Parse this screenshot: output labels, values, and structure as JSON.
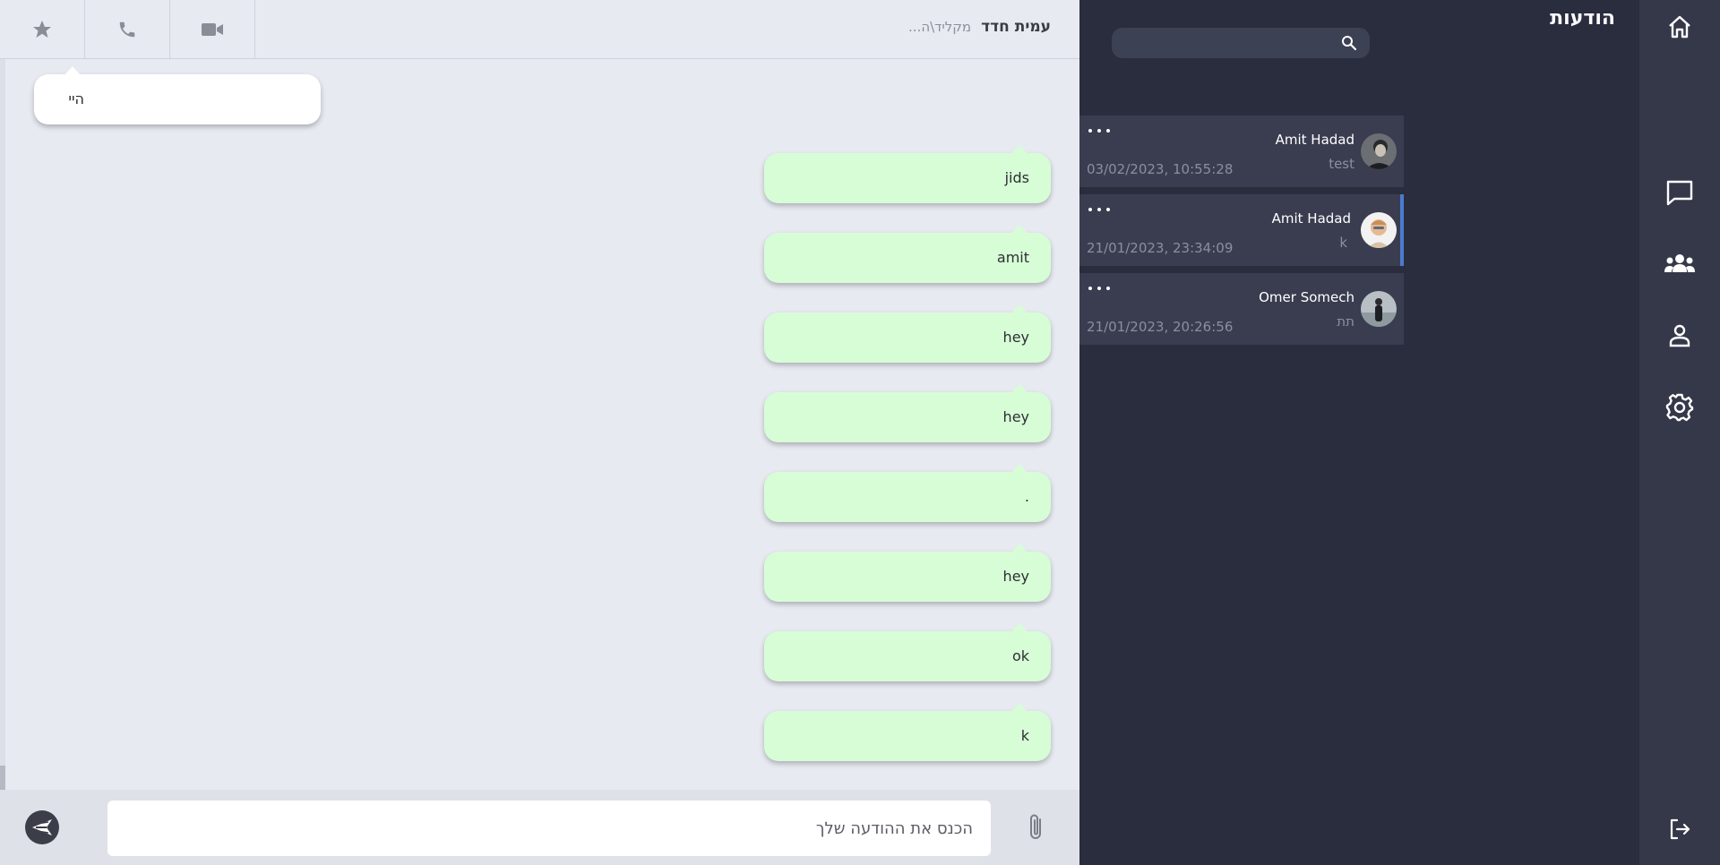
{
  "header": {
    "contact_name": "עמית חדד",
    "status": "מקליד\\ה..."
  },
  "page_title": "הודעות",
  "messages": [
    {
      "dir": "in",
      "text": "היי"
    },
    {
      "dir": "out",
      "text": "jids"
    },
    {
      "dir": "out",
      "text": "amit"
    },
    {
      "dir": "out",
      "text": "hey"
    },
    {
      "dir": "out",
      "text": "hey"
    },
    {
      "dir": "out",
      "text": "."
    },
    {
      "dir": "out",
      "text": "hey"
    },
    {
      "dir": "out",
      "text": "ok"
    },
    {
      "dir": "out",
      "text": "k"
    }
  ],
  "composer": {
    "placeholder": "הכנס את ההודעה שלך"
  },
  "search": {
    "placeholder": ""
  },
  "conversations": [
    {
      "name": "Amit Hadad",
      "preview": "test",
      "time": "03/02/2023, 10:55:28",
      "active": false
    },
    {
      "name": "Amit Hadad",
      "preview": "k",
      "time": "21/01/2023, 23:34:09",
      "active": true
    },
    {
      "name": "Omer Somech",
      "preview": "תת",
      "time": "21/01/2023, 20:26:56",
      "active": false
    }
  ],
  "icons": {
    "header": [
      "star-icon",
      "phone-icon",
      "video-icon"
    ],
    "nav": [
      "home-icon",
      "chat-icon",
      "groups-icon",
      "profile-icon",
      "settings-icon",
      "logout-icon"
    ],
    "composer": [
      "send-icon",
      "paperclip-icon"
    ]
  },
  "colors": {
    "outgoing_bubble": "#d7fdd6",
    "incoming_bubble": "#ffffff",
    "sidebar_bg": "#2a2d3d",
    "nav_bg": "#353849",
    "active_accent": "#4a7bd0"
  }
}
